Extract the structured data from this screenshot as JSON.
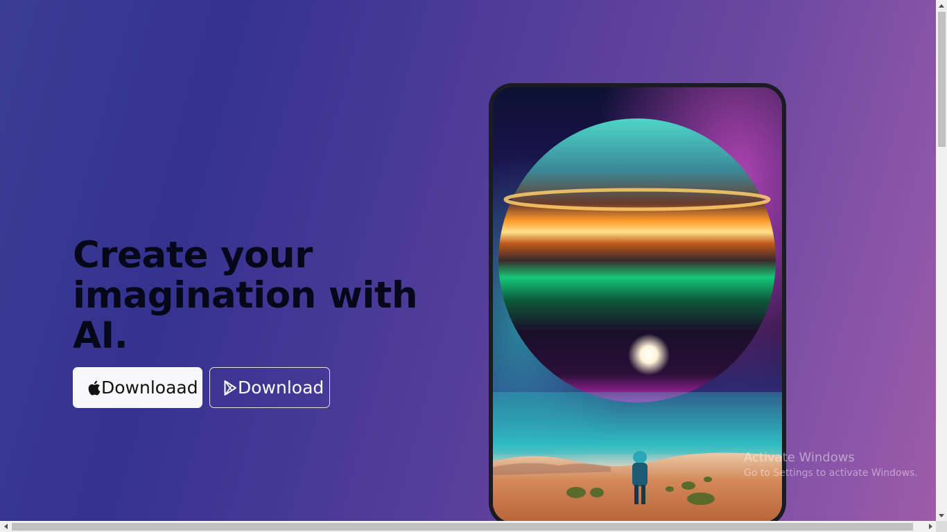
{
  "hero": {
    "headline": "Create your imagination with AI."
  },
  "buttons": {
    "apple_label": "Downloaad",
    "play_label": "Download",
    "apple_icon": "apple-icon",
    "play_icon": "play-store-icon"
  },
  "watermark": {
    "line1": "Activate Windows",
    "line2": "Go to Settings to activate Windows."
  },
  "colors": {
    "headline": "#07071a",
    "apple_button_bg": "#f8f8fa",
    "phone_frame": "#1b1b24"
  }
}
